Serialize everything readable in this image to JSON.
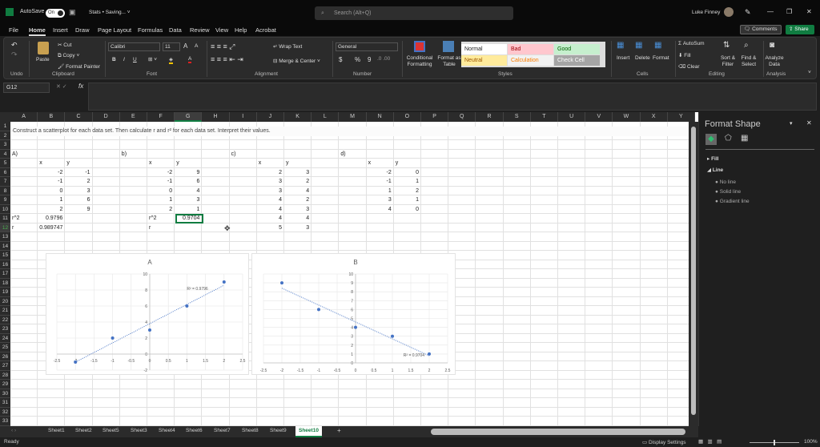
{
  "titlebar": {
    "autosave_label": "AutoSave",
    "autosave_state": "On",
    "doc_title": "Stats • Saving... ˅",
    "search_placeholder": "Search (Alt+Q)",
    "user": "Luke Finney",
    "minimize": "—",
    "restore": "❐",
    "close": "✕"
  },
  "menu": {
    "tabs": [
      "File",
      "Home",
      "Insert",
      "Draw",
      "Page Layout",
      "Formulas",
      "Data",
      "Review",
      "View",
      "Help",
      "Acrobat"
    ],
    "active": "Home",
    "comments": "Comments",
    "share": "Share"
  },
  "ribbon": {
    "undo": {
      "group": "Undo"
    },
    "clipboard": {
      "paste": "Paste",
      "cut": "Cut",
      "copy": "Copy",
      "format_painter": "Format Painter",
      "group": "Clipboard"
    },
    "font": {
      "name": "Calibri",
      "size": "11",
      "bold": "B",
      "italic": "I",
      "underline": "U",
      "group": "Font"
    },
    "alignment": {
      "wrap": "Wrap Text",
      "merge": "Merge & Center",
      "group": "Alignment"
    },
    "number": {
      "format": "General",
      "currency": "$",
      "percent": "%",
      "comma": "9",
      "group": "Number"
    },
    "styles": {
      "conditional": "Conditional Formatting",
      "format_table": "Format as Table",
      "cells": [
        {
          "label": "Normal",
          "bg": "#ffffff",
          "fg": "#222222"
        },
        {
          "label": "Bad",
          "bg": "#ffc7ce",
          "fg": "#9c0006"
        },
        {
          "label": "Good",
          "bg": "#c6efce",
          "fg": "#006100"
        },
        {
          "label": "Neutral",
          "bg": "#ffeb9c",
          "fg": "#9c5700"
        },
        {
          "label": "Calculation",
          "bg": "#f2f2f2",
          "fg": "#fa7d00"
        },
        {
          "label": "Check Cell",
          "bg": "#a5a5a5",
          "fg": "#ffffff"
        }
      ],
      "group": "Styles"
    },
    "cells": {
      "insert": "Insert",
      "delete": "Delete",
      "format": "Format",
      "group": "Cells"
    },
    "editing": {
      "autosum": "AutoSum",
      "fill": "Fill",
      "clear": "Clear",
      "sort": "Sort & Filter",
      "find": "Find & Select",
      "group": "Editing"
    },
    "analysis": {
      "analyze": "Analyze Data",
      "group": "Analysis"
    }
  },
  "formula_bar": {
    "name_box": "G12",
    "fx": "fx",
    "value": ""
  },
  "sheet": {
    "columns": [
      "A",
      "B",
      "C",
      "D",
      "E",
      "F",
      "G",
      "H",
      "I",
      "J",
      "K",
      "L",
      "M",
      "N",
      "O",
      "P",
      "Q",
      "R",
      "S",
      "T",
      "U",
      "V",
      "W",
      "X",
      "Y"
    ],
    "selected_column": "G",
    "selected_row": 12,
    "row_count": 33,
    "instruction": "Construct a scatterplot for each data set. Then calculate r and r² for each data set. Interpret their values.",
    "cells": [
      {
        "ref": "A4",
        "v": "A)"
      },
      {
        "ref": "E4",
        "v": "b)"
      },
      {
        "ref": "I4",
        "v": "c)"
      },
      {
        "ref": "M4",
        "v": "d)"
      },
      {
        "ref": "B5",
        "v": "x"
      },
      {
        "ref": "C5",
        "v": "y"
      },
      {
        "ref": "F5",
        "v": "x"
      },
      {
        "ref": "G5",
        "v": "y"
      },
      {
        "ref": "J5",
        "v": "x"
      },
      {
        "ref": "K5",
        "v": "y"
      },
      {
        "ref": "N5",
        "v": "x"
      },
      {
        "ref": "O5",
        "v": "y"
      },
      {
        "ref": "B6",
        "v": "-2",
        "n": 1
      },
      {
        "ref": "C6",
        "v": "-1",
        "n": 1
      },
      {
        "ref": "F6",
        "v": "-2",
        "n": 1
      },
      {
        "ref": "G6",
        "v": "9",
        "n": 1
      },
      {
        "ref": "J6",
        "v": "2",
        "n": 1
      },
      {
        "ref": "K6",
        "v": "3",
        "n": 1
      },
      {
        "ref": "N6",
        "v": "-2",
        "n": 1
      },
      {
        "ref": "O6",
        "v": "0",
        "n": 1
      },
      {
        "ref": "B7",
        "v": "-1",
        "n": 1
      },
      {
        "ref": "C7",
        "v": "2",
        "n": 1
      },
      {
        "ref": "F7",
        "v": "-1",
        "n": 1
      },
      {
        "ref": "G7",
        "v": "6",
        "n": 1
      },
      {
        "ref": "J7",
        "v": "3",
        "n": 1
      },
      {
        "ref": "K7",
        "v": "2",
        "n": 1
      },
      {
        "ref": "N7",
        "v": "-1",
        "n": 1
      },
      {
        "ref": "O7",
        "v": "1",
        "n": 1
      },
      {
        "ref": "B8",
        "v": "0",
        "n": 1
      },
      {
        "ref": "C8",
        "v": "3",
        "n": 1
      },
      {
        "ref": "F8",
        "v": "0",
        "n": 1
      },
      {
        "ref": "G8",
        "v": "4",
        "n": 1
      },
      {
        "ref": "J8",
        "v": "3",
        "n": 1
      },
      {
        "ref": "K8",
        "v": "4",
        "n": 1
      },
      {
        "ref": "N8",
        "v": "1",
        "n": 1
      },
      {
        "ref": "O8",
        "v": "2",
        "n": 1
      },
      {
        "ref": "B9",
        "v": "1",
        "n": 1
      },
      {
        "ref": "C9",
        "v": "6",
        "n": 1
      },
      {
        "ref": "F9",
        "v": "1",
        "n": 1
      },
      {
        "ref": "G9",
        "v": "3",
        "n": 1
      },
      {
        "ref": "J9",
        "v": "4",
        "n": 1
      },
      {
        "ref": "K9",
        "v": "2",
        "n": 1
      },
      {
        "ref": "N9",
        "v": "3",
        "n": 1
      },
      {
        "ref": "O9",
        "v": "1",
        "n": 1
      },
      {
        "ref": "B10",
        "v": "2",
        "n": 1
      },
      {
        "ref": "C10",
        "v": "9",
        "n": 1
      },
      {
        "ref": "F10",
        "v": "2",
        "n": 1
      },
      {
        "ref": "G10",
        "v": "1",
        "n": 1
      },
      {
        "ref": "J10",
        "v": "4",
        "n": 1
      },
      {
        "ref": "K10",
        "v": "3",
        "n": 1
      },
      {
        "ref": "N10",
        "v": "4",
        "n": 1
      },
      {
        "ref": "O10",
        "v": "0",
        "n": 1
      },
      {
        "ref": "A11",
        "v": "r^2"
      },
      {
        "ref": "B11",
        "v": "0.9796",
        "n": 1
      },
      {
        "ref": "F11",
        "v": "r^2"
      },
      {
        "ref": "G11",
        "v": "0.9704",
        "n": 1
      },
      {
        "ref": "J11",
        "v": "4",
        "n": 1
      },
      {
        "ref": "K11",
        "v": "4",
        "n": 1
      },
      {
        "ref": "A12",
        "v": "r"
      },
      {
        "ref": "B12",
        "v": "0.989747",
        "n": 1
      },
      {
        "ref": "F12",
        "v": "r"
      },
      {
        "ref": "J12",
        "v": "5",
        "n": 1
      },
      {
        "ref": "K12",
        "v": "3",
        "n": 1
      }
    ]
  },
  "chart_data": [
    {
      "type": "scatter",
      "title": "A",
      "x": [
        -2,
        -1,
        0,
        1,
        2
      ],
      "y": [
        -1,
        2,
        3,
        6,
        9
      ],
      "xlim": [
        -2.5,
        2.5
      ],
      "ylim": [
        -2,
        10
      ],
      "xticks": [
        "-2.5",
        "-2",
        "-1.5",
        "-1",
        "-0.5",
        "0",
        "0.5",
        "1",
        "1.5",
        "2",
        "2.5"
      ],
      "yticks": [
        "-2",
        "0",
        "2",
        "4",
        "6",
        "8",
        "10"
      ],
      "ystep": 2,
      "trendline": {
        "slope": 2.4,
        "intercept": 3.8,
        "label": "R² = 0.9796"
      }
    },
    {
      "type": "scatter",
      "title": "B",
      "x": [
        -2,
        -1,
        0,
        1,
        2
      ],
      "y": [
        9,
        6,
        4,
        3,
        1
      ],
      "xlim": [
        -2.5,
        2.5
      ],
      "ylim": [
        0,
        10
      ],
      "xticks": [
        "-2.5",
        "-2",
        "-1.5",
        "-1",
        "-0.5",
        "0",
        "0.5",
        "1",
        "1.5",
        "2",
        "2.5"
      ],
      "yticks": [
        "0",
        "1",
        "2",
        "3",
        "4",
        "5",
        "6",
        "7",
        "8",
        "9",
        "10"
      ],
      "ystep": 1,
      "trendline": {
        "slope": -1.9,
        "intercept": 4.6,
        "label": "R² = 0.9704"
      }
    }
  ],
  "format_pane": {
    "title": "Format Shape",
    "fill": "Fill",
    "line": "Line",
    "options": [
      "No line",
      "Solid line",
      "Gradient line"
    ]
  },
  "sheet_tabs": {
    "tabs": [
      "Sheet1",
      "Sheet2",
      "Sheet5",
      "Sheet3",
      "Sheet4",
      "Sheet6",
      "Sheet7",
      "Sheet8",
      "Sheet9",
      "Sheet10"
    ],
    "active": "Sheet10",
    "add": "+"
  },
  "status": {
    "ready": "Ready",
    "display_settings": "Display Settings",
    "zoom": "100%"
  },
  "colors": {
    "accent": "#107c41",
    "point": "#4472c4"
  }
}
